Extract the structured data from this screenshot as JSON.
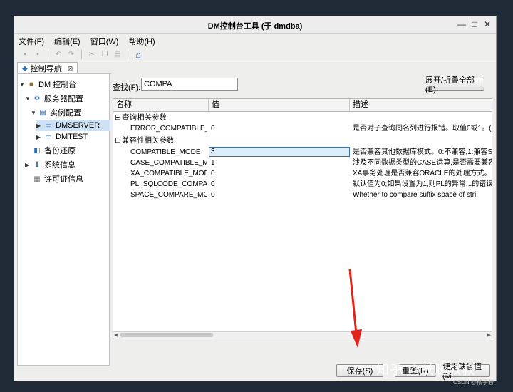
{
  "window": {
    "title": "DM控制台工具 (于 dmdba)"
  },
  "menu": [
    "文件(F)",
    "编辑(E)",
    "窗口(W)",
    "帮助(H)"
  ],
  "tab": {
    "label": "控制导航",
    "close": "⊠"
  },
  "tree": [
    {
      "label": "DM 控制台",
      "depth": 0,
      "toggle": "▼",
      "icon": "db-icon"
    },
    {
      "label": "服务器配置",
      "depth": 1,
      "toggle": "▼",
      "icon": "gear-icon"
    },
    {
      "label": "实例配置",
      "depth": 2,
      "toggle": "▼",
      "icon": "instance-icon"
    },
    {
      "label": "DMSERVER",
      "depth": 3,
      "toggle": "▶",
      "icon": "server-icon",
      "selected": true
    },
    {
      "label": "DMTEST",
      "depth": 3,
      "toggle": "▶",
      "icon": "server-icon"
    },
    {
      "label": "备份还原",
      "depth": 1,
      "toggle": "",
      "icon": "backup-icon"
    },
    {
      "label": "系统信息",
      "depth": 1,
      "toggle": "▶",
      "icon": "info-icon"
    },
    {
      "label": "许可证信息",
      "depth": 1,
      "toggle": "",
      "icon": "license-icon"
    }
  ],
  "search": {
    "label": "查找(F):",
    "value": "COMPA"
  },
  "buttons": {
    "expand_all": "展开/折叠全部(E)",
    "save": "保存(S)",
    "reset": "重置(R)",
    "defaults": "使用缺省值(M"
  },
  "grid": {
    "columns": [
      "名称",
      "值",
      "描述"
    ],
    "groups": [
      {
        "title": "查询相关参数",
        "rows": [
          {
            "name": "ERROR_COMPATIBLE_F",
            "value": "0",
            "desc": "是否对子查询同名列进行报错。取值0或1。("
          }
        ]
      },
      {
        "title": "兼容性相关参数",
        "rows": [
          {
            "name": "COMPATIBLE_MODE",
            "value": "3",
            "desc": "是否兼容其他数据库模式。0:不兼容,1:兼容S",
            "editing": true
          },
          {
            "name": "CASE_COMPATIBLE_MC",
            "value": "1",
            "desc": "涉及不同数据类型的CASE运算,是否需要兼容"
          },
          {
            "name": "XA_COMPATIBLE_MOD",
            "value": "0",
            "desc": "XA事务处理是否兼容ORACLE的处理方式。("
          },
          {
            "name": "PL_SQLCODE_COMPAT",
            "value": "0",
            "desc": "默认值为0;如果设置为1,则PL的异常...的错误"
          },
          {
            "name": "SPACE_COMPARE_MOI",
            "value": "0",
            "desc": "Whether to compare suffix space of stri"
          }
        ]
      }
    ]
  },
  "overlay": {
    "watermark": "知乎 @长腿叔叔",
    "csdn": "CSDN @橘子巷",
    "status_partial": "12271.3 ..."
  },
  "colors": {
    "arrow": "#e2231a",
    "selection": "#cfe2f5",
    "editing_border": "#3a6ea5"
  }
}
